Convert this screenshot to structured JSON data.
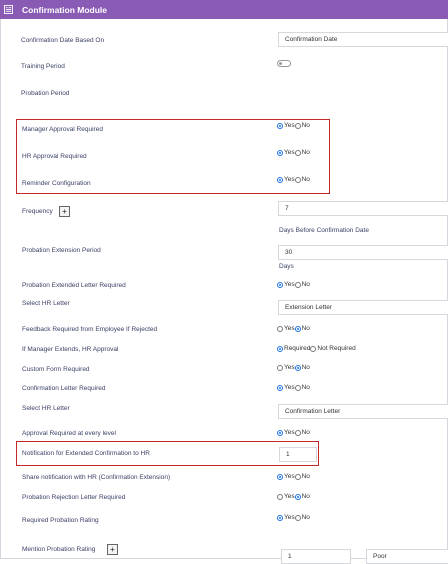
{
  "header": {
    "title": "Confirmation Module",
    "icon": "module-icon"
  },
  "labels": {
    "confirmation_date_based_on": "Confirmation Date Based On",
    "training_period": "Training Period",
    "probation_period": "Probation Period",
    "manager_approval_required": "Manager Approval Required",
    "hr_approval_required": "HR Approval Required",
    "reminder_configuration": "Reminder Configuration",
    "frequency": "Frequency",
    "probation_extension_period": "Probation Extension Period",
    "probation_extended_letter_required": "Probation Extended Letter Required",
    "select_hr_letter": "Select HR Letter",
    "feedback_required": "Feedback Required from Employee If Rejected",
    "if_manager_extends": "If Manager Extends, HR Approval",
    "custom_form_required": "Custom Form Required",
    "confirmation_letter_required": "Confirmation Letter Required",
    "select_hr_letter_2": "Select HR Letter",
    "approval_required_every_level": "Approval Required at every level",
    "notification_extended_confirmation": "Notification for Extended Confirmation to HR",
    "share_notification_hr": "Share notification with HR (Confirmation Extension)",
    "probation_rejection_letter_required": "Probation Rejection Letter Required",
    "required_probation_rating": "Required Probation Rating",
    "mention_probation_rating": "Mention Probation Rating"
  },
  "values": {
    "confirmation_date": "Confirmation Date",
    "frequency": "7",
    "days_before_confirmation": "Days Before Confirmation Date",
    "extension_period": "30",
    "extension_unit": "Days",
    "hr_letter": "Extension Letter",
    "hr_letter_2": "Confirmation Letter",
    "notification_value": "1",
    "rating_value": "1",
    "rating_grade": "Poor"
  },
  "options": {
    "yes": "Yes",
    "no": "No",
    "required": "Required",
    "not_required": "Not Required"
  },
  "colors": {
    "header_bg": "#8a5bb5",
    "highlight_border": "#c62828",
    "radio_selected": "#1a73e8"
  }
}
